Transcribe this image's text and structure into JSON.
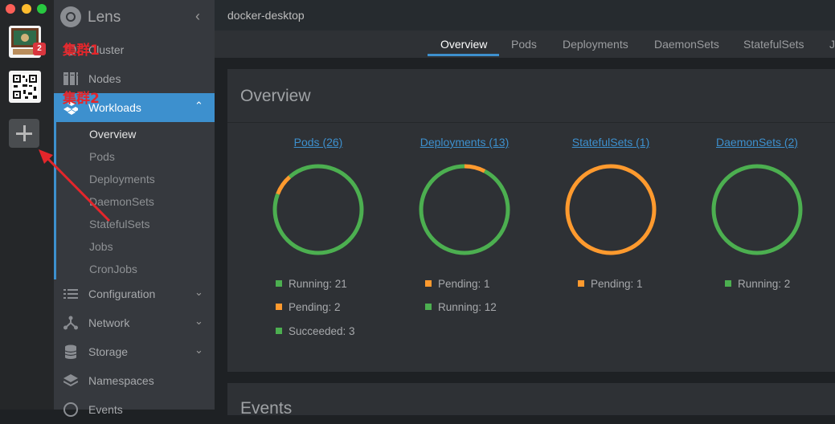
{
  "app": {
    "title": "Lens"
  },
  "clusters": {
    "badge_count": "2",
    "annotations": [
      "集群1",
      "集群2"
    ]
  },
  "sidebar": {
    "items": {
      "cluster": "Cluster",
      "nodes": "Nodes",
      "workloads": "Workloads",
      "configuration": "Configuration",
      "network": "Network",
      "storage": "Storage",
      "namespaces": "Namespaces",
      "events": "Events"
    },
    "workload_subitems": [
      "Overview",
      "Pods",
      "Deployments",
      "DaemonSets",
      "StatefulSets",
      "Jobs",
      "CronJobs"
    ],
    "active_subitem": "Overview"
  },
  "topbar": {
    "cluster_name": "docker-desktop"
  },
  "tabs": [
    "Overview",
    "Pods",
    "Deployments",
    "DaemonSets",
    "StatefulSets",
    "J"
  ],
  "active_tab": "Overview",
  "overview": {
    "title": "Overview",
    "colors": {
      "running": "#4caf50",
      "pending": "#ff9a2e",
      "succeeded": "#4caf50"
    },
    "charts": [
      {
        "title": "Pods (26)",
        "segments": [
          {
            "label": "Running",
            "value": 21,
            "color": "#4caf50"
          },
          {
            "label": "Pending",
            "value": 2,
            "color": "#ff9a2e"
          },
          {
            "label": "Succeeded",
            "value": 3,
            "color": "#4caf50"
          }
        ],
        "legend": [
          "Running: 21",
          "Pending: 2",
          "Succeeded: 3"
        ]
      },
      {
        "title": "Deployments (13)",
        "segments": [
          {
            "label": "Pending",
            "value": 1,
            "color": "#ff9a2e"
          },
          {
            "label": "Running",
            "value": 12,
            "color": "#4caf50"
          }
        ],
        "legend": [
          "Pending: 1",
          "Running: 12"
        ]
      },
      {
        "title": "StatefulSets (1)",
        "segments": [
          {
            "label": "Pending",
            "value": 1,
            "color": "#ff9a2e"
          }
        ],
        "legend": [
          "Pending: 1"
        ]
      },
      {
        "title": "DaemonSets (2)",
        "segments": [
          {
            "label": "Running",
            "value": 2,
            "color": "#4caf50"
          }
        ],
        "legend": [
          "Running: 2"
        ]
      }
    ]
  },
  "events": {
    "title": "Events"
  }
}
